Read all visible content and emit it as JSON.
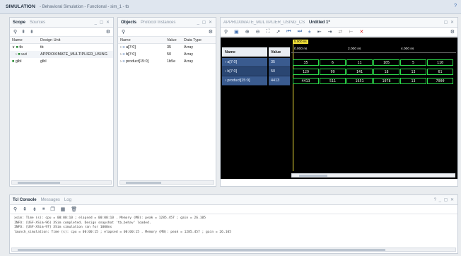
{
  "app": {
    "title": "SIMULATION",
    "subtitle": "- Behavioral Simulation - Functional - sim_1 - tb",
    "help_icon": "help-icon"
  },
  "scope": {
    "tabs": [
      "Scope",
      "Sources"
    ],
    "toolbar_icons": [
      "search-icon",
      "collapse-icon",
      "expand-icon",
      "gear-icon"
    ],
    "headers": [
      "Name",
      "Design Unit"
    ],
    "rows": [
      {
        "indent": 0,
        "name": "tb",
        "unit": "tb"
      },
      {
        "indent": 1,
        "name": "uut",
        "unit": "APPROXIMATE_MULTIPLIER_USING"
      },
      {
        "indent": 0,
        "name": "glbl",
        "unit": "glbl"
      }
    ]
  },
  "objects": {
    "tabs": [
      "Objects",
      "Protocol Instances"
    ],
    "headers": [
      "Name",
      "Value",
      "Data Type"
    ],
    "rows": [
      {
        "name": "a[7:0]",
        "value": "35",
        "type": "Array"
      },
      {
        "name": "b[7:0]",
        "value": "50",
        "type": "Array"
      },
      {
        "name": "product[15:0]",
        "value": "1b5e",
        "type": "Array"
      }
    ]
  },
  "wave": {
    "tabs": [
      "APPROXIMATE_MULTIPLIER_USING_CSEA.v",
      "Untitled 1*"
    ],
    "toolbar_icons": [
      "search-icon",
      "save-icon",
      "zoom-in-icon",
      "zoom-out-icon",
      "zoom-fit-icon",
      "arrow-icon",
      "go-start-icon",
      "go-end-icon",
      "add-marker-icon",
      "prev-marker-icon",
      "next-marker-icon",
      "swap-icon",
      "snap-icon",
      "close-icon",
      "gear-icon"
    ],
    "headers": [
      "Name",
      "Value"
    ],
    "marker": "5.000 ns",
    "time_labels": [
      "0.000 ns",
      "2.000 ns",
      "4.000 ns"
    ],
    "signals": [
      {
        "name": "a[7:0]",
        "value": "35",
        "segments": [
          "35",
          "6",
          "11",
          "105",
          "5",
          "110"
        ]
      },
      {
        "name": "b[7:0]",
        "value": "50",
        "segments": [
          "129",
          "99",
          "141",
          "18",
          "13",
          "61"
        ]
      },
      {
        "name": "product[15:0]",
        "value": "4413",
        "segments": [
          "4413",
          "511",
          "1651",
          "1078",
          "13",
          "7000"
        ]
      }
    ]
  },
  "console": {
    "tabs": [
      "Tcl Console",
      "Messages",
      "Log"
    ],
    "toolbar_icons": [
      "search-icon",
      "collapse-icon",
      "expand-icon",
      "pause-icon",
      "copy-icon",
      "table-icon",
      "delete-icon"
    ],
    "lines": [
      "xsim: Time (s): cpu = 00:00:10 ; elapsed = 00:00:10 . Memory (MB): peak = 1285.457 ; gain = 26.105",
      "INFO: [USF-XSim-96] XSim completed. Design snapshot 'tb_behav' loaded.",
      "INFO: [USF-XSim-97] XSim simulation ran for 1000ns",
      "launch_simulation: Time (s): cpu = 00:00:15 ; elapsed = 00:00:15 . Memory (MB): peak = 1285.457 ; gain = 26.105"
    ]
  }
}
